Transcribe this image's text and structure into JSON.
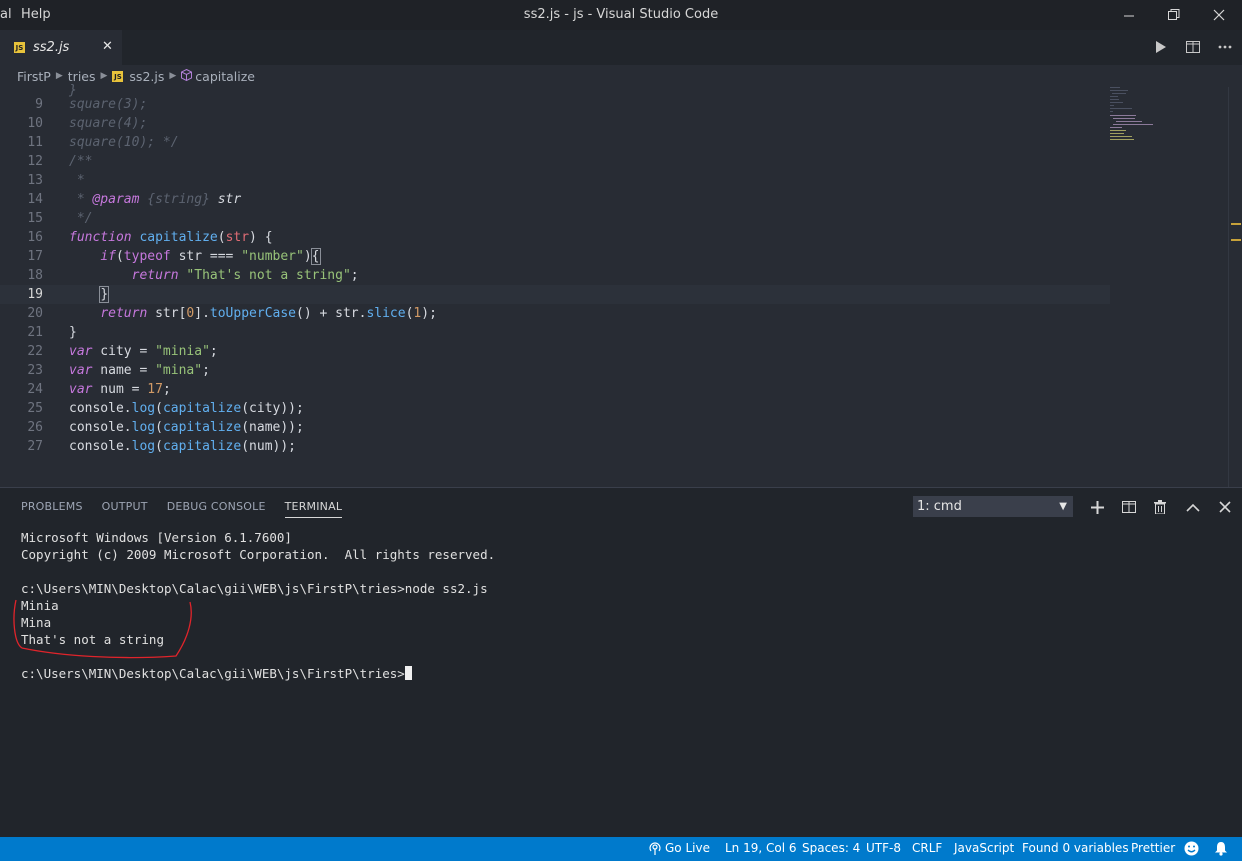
{
  "window": {
    "title": "ss2.js - js - Visual Studio Code",
    "menu": [
      "al",
      "Help"
    ]
  },
  "tab": {
    "icon_text": "JS",
    "label": "ss2.js"
  },
  "breadcrumb": [
    "FirstP",
    "tries",
    "ss2.js",
    "capitalize"
  ],
  "editor": {
    "line_numbers": [
      "9",
      "10",
      "11",
      "12",
      "13",
      "14",
      "15",
      "16",
      "17",
      "18",
      "19",
      "20",
      "21",
      "22",
      "23",
      "24",
      "25",
      "26",
      "27"
    ],
    "current_line": "19"
  },
  "panel": {
    "tabs": [
      "PROBLEMS",
      "OUTPUT",
      "DEBUG CONSOLE",
      "TERMINAL"
    ],
    "active_tab": "TERMINAL",
    "terminal_select": "1: cmd",
    "terminal_lines": [
      "Microsoft Windows [Version 6.1.7600]",
      "Copyright (c) 2009 Microsoft Corporation.  All rights reserved.",
      "",
      "c:\\Users\\MIN\\Desktop\\Calac\\gii\\WEB\\js\\FirstP\\tries>node ss2.js",
      "Minia",
      "Mina",
      "That's not a string",
      ""
    ],
    "prompt": "c:\\Users\\MIN\\Desktop\\Calac\\gii\\WEB\\js\\FirstP\\tries>"
  },
  "statusbar": {
    "go_live": "Go Live",
    "position": "Ln 19, Col 6",
    "spaces": "Spaces: 4",
    "encoding": "UTF-8",
    "eol": "CRLF",
    "language": "JavaScript",
    "variables": "Found 0 variables",
    "formatter": "Prettier"
  },
  "colors": {
    "statusbar": "#007acc",
    "annotation": "#e0242b"
  }
}
